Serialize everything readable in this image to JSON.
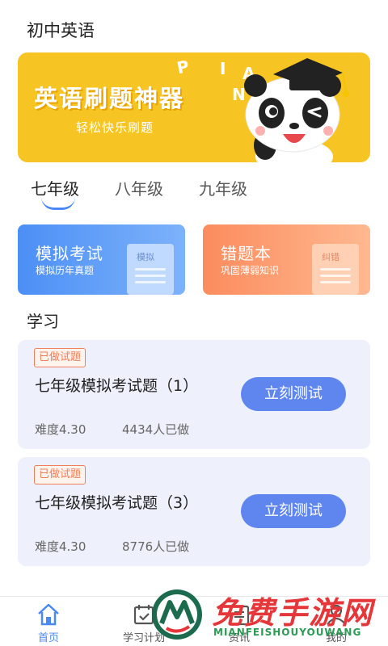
{
  "header": {
    "title": "初中英语"
  },
  "banner": {
    "main_text": "英语刷题神器",
    "sub_text": "轻松快乐刷题",
    "letters": [
      "P",
      "I",
      "A",
      "N"
    ],
    "color": "#f7c523"
  },
  "tabs": [
    {
      "label": "七年级",
      "active": true
    },
    {
      "label": "八年级",
      "active": false
    },
    {
      "label": "九年级",
      "active": false
    }
  ],
  "cards": [
    {
      "title": "模拟考试",
      "subtitle": "模拟历年真题",
      "doc_label": "模拟",
      "color": "#4c8ff5"
    },
    {
      "title": "错题本",
      "subtitle": "巩固薄弱知识",
      "doc_label": "纠错",
      "color": "#fb8c5e"
    }
  ],
  "section": {
    "title": "学习"
  },
  "quizzes": [
    {
      "tag": "已做试题",
      "title": "七年级模拟考试题（1）",
      "difficulty": "难度4.30",
      "count": "4434人已做",
      "button": "立刻测试"
    },
    {
      "tag": "已做试题",
      "title": "七年级模拟考试题（3）",
      "difficulty": "难度4.30",
      "count": "8776人已做",
      "button": "立刻测试"
    }
  ],
  "bottom_nav": [
    {
      "label": "首页",
      "icon": "home-icon",
      "active": true
    },
    {
      "label": "学习计划",
      "icon": "calendar-icon",
      "active": false
    },
    {
      "label": "资讯",
      "icon": "news-icon",
      "active": false
    },
    {
      "label": "我的",
      "icon": "user-icon",
      "active": false
    }
  ],
  "watermark": {
    "title": "免费手游网",
    "subtitle": "MIANFEISHOUYOUWANG"
  },
  "colors": {
    "accent": "#4a88f5",
    "button": "#5f86ef",
    "tag": "#ee7f5a"
  }
}
